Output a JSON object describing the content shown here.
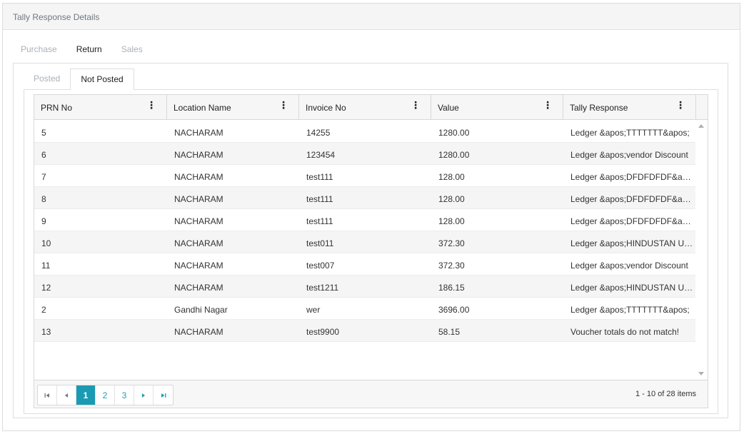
{
  "panel": {
    "title": "Tally Response Details"
  },
  "top_tabs": [
    {
      "label": "Purchase",
      "active": false
    },
    {
      "label": "Return",
      "active": true
    },
    {
      "label": "Sales",
      "active": false
    }
  ],
  "sub_tabs": [
    {
      "label": "Posted",
      "active": false
    },
    {
      "label": "Not Posted",
      "active": true
    }
  ],
  "grid": {
    "columns": [
      "PRN No",
      "Location Name",
      "Invoice No",
      "Value",
      "Tally Response"
    ],
    "rows": [
      [
        "5",
        "NACHARAM",
        "14255",
        "1280.00",
        "Ledger &apos;TTTTTTT&apos;"
      ],
      [
        "6",
        "NACHARAM",
        "123454",
        "1280.00",
        "Ledger &apos;vendor Discount"
      ],
      [
        "7",
        "NACHARAM",
        "test111",
        "128.00",
        "Ledger &apos;DFDFDFDF&apos;"
      ],
      [
        "8",
        "NACHARAM",
        "test111",
        "128.00",
        "Ledger &apos;DFDFDFDF&apos;"
      ],
      [
        "9",
        "NACHARAM",
        "test111",
        "128.00",
        "Ledger &apos;DFDFDFDF&apos;"
      ],
      [
        "10",
        "NACHARAM",
        "test011",
        "372.30",
        "Ledger &apos;HINDUSTAN UNILEVER"
      ],
      [
        "11",
        "NACHARAM",
        "test007",
        "372.30",
        "Ledger &apos;vendor Discount"
      ],
      [
        "12",
        "NACHARAM",
        "test1211",
        "186.15",
        "Ledger &apos;HINDUSTAN UNILEVER"
      ],
      [
        "2",
        "Gandhi Nagar",
        "wer",
        "3696.00",
        "Ledger &apos;TTTTTTT&apos;"
      ],
      [
        "13",
        "NACHARAM",
        "test9900",
        "58.15",
        "Voucher totals do not match!"
      ]
    ]
  },
  "pager": {
    "first_icon": "first-page-icon",
    "prev_icon": "prev-page-icon",
    "next_icon": "next-page-icon",
    "last_icon": "last-page-icon",
    "pages": [
      "1",
      "2",
      "3"
    ],
    "current": "1",
    "info": "1 - 10 of 28 items"
  }
}
